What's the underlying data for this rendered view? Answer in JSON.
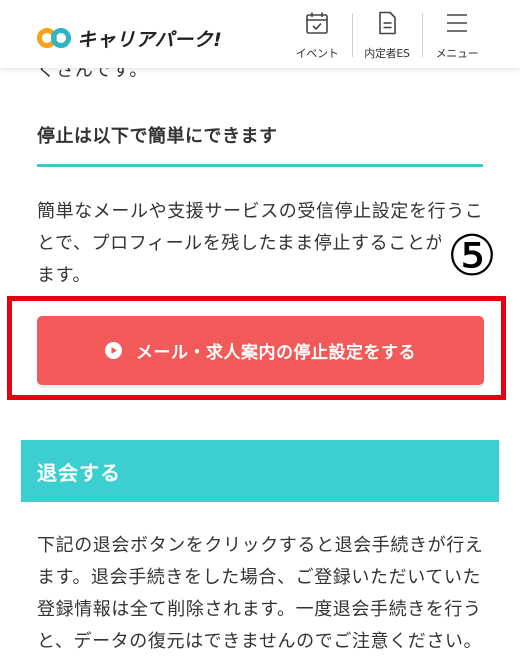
{
  "header": {
    "logo_text": "キャリアパーク!",
    "nav": [
      {
        "label": "イベント",
        "icon": "calendar-icon"
      },
      {
        "label": "内定者ES",
        "icon": "document-icon"
      },
      {
        "label": "メニュー",
        "icon": "hamburger-menu-icon"
      }
    ]
  },
  "content": {
    "partial_line": "くさんです。",
    "section_heading": "停止は以下で簡単にできます",
    "paragraph1": "簡単なメールや支援サービスの受信停止設定を行うことで、プロフィールを残したまま停止することができます。",
    "annotation_number": "⑤",
    "stop_button_label": "メール・求人案内の停止設定をする",
    "withdraw_title": "退会する",
    "paragraph2": "下記の退会ボタンをクリックすると退会手続きが行えます。退会手続きをした場合、ご登録いただいていた登録情報は全て削除されます。一度退会手続きを行うと、データの復元はできませんのでご注意ください。"
  },
  "colors": {
    "teal_accent": "#3cc6c6",
    "button_red": "#f25a5a",
    "annotation_red": "#e60012",
    "logo_orange": "#f7a21b",
    "logo_teal": "#2bb5c5"
  }
}
